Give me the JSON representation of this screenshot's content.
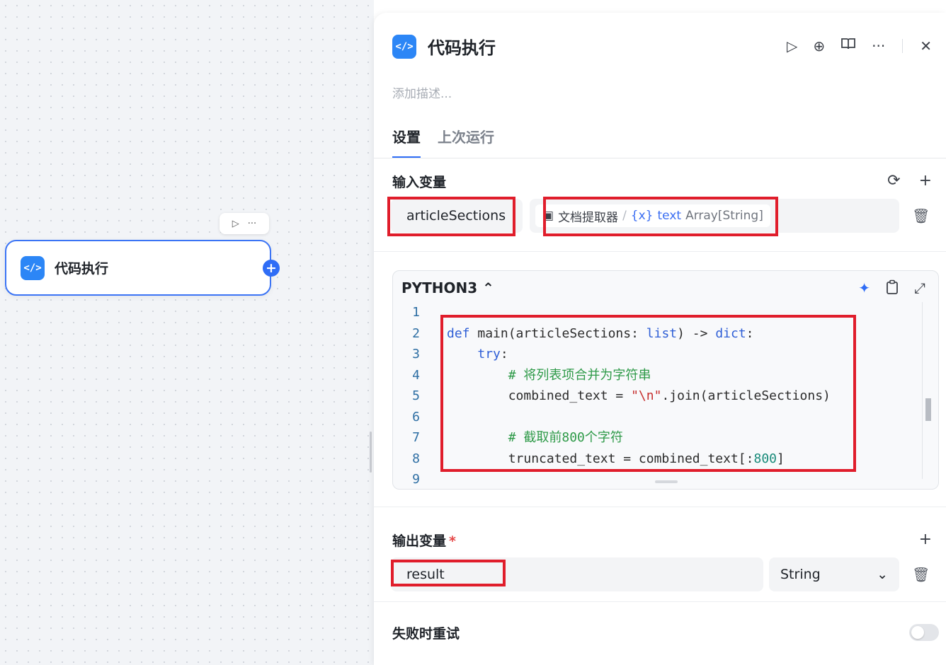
{
  "canvas": {
    "node_title": "代码执行",
    "node_icon": "code-icon",
    "toolbar_run": "▷",
    "toolbar_more": "···",
    "plus": "+"
  },
  "panel": {
    "title": "代码执行",
    "description_placeholder": "添加描述...",
    "tabs": [
      {
        "label": "设置",
        "active": true
      },
      {
        "label": "上次运行",
        "active": false
      }
    ],
    "header_icons": [
      "run-icon",
      "locate-icon",
      "docs-icon",
      "more-icon",
      "close-icon"
    ],
    "input_section": {
      "label": "输入变量",
      "var_name": "articleSections",
      "ref_node": "文档提取器",
      "ref_var": "text",
      "ref_type": "Array[String]"
    },
    "code_editor": {
      "language": "PYTHON3",
      "line_numbers": [
        "1",
        "2",
        "3",
        "4",
        "5",
        "6",
        "7",
        "8",
        "9"
      ]
    },
    "output_section": {
      "label": "输出变量",
      "required_mark": "*",
      "var_name": "result",
      "type": "String"
    },
    "retry_section": {
      "label": "失败时重试",
      "enabled": false
    }
  },
  "colors": {
    "accent": "#2f6df6",
    "node_icon_bg": "#2c86f6",
    "highlight": "#e01d2b"
  }
}
